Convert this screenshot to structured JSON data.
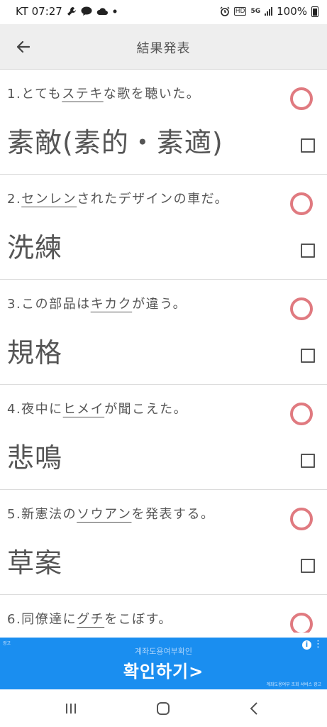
{
  "status_bar": {
    "carrier_time": "KT 07:27",
    "left_icons": [
      "wrench-icon",
      "talk-icon",
      "cloud-icon",
      "dot-icon"
    ],
    "right_icons": [
      "alarm-icon",
      "hd-icon",
      "5g-icon",
      "signal-icon"
    ],
    "hd_label": "HD",
    "network_label": "5G",
    "battery": "100%"
  },
  "header": {
    "back_icon": "arrow-left-icon",
    "title": "結果発表"
  },
  "colors": {
    "correct_circle": "#e07a80",
    "header_bg": "#eeeeee",
    "ad_bg": "#1a8ef0"
  },
  "results": [
    {
      "prefix": "1.とても",
      "kana": "ステキ",
      "suffix": "な歌を聴いた。",
      "answer": "素敵(素的・素適)",
      "mark": "correct-circle-icon"
    },
    {
      "prefix": "2.",
      "kana": "センレン",
      "suffix": "されたデザインの車だ。",
      "answer": "洗練",
      "mark": "correct-circle-icon"
    },
    {
      "prefix": "3.この部品は",
      "kana": "キカク",
      "suffix": "が違う。",
      "answer": "規格",
      "mark": "correct-circle-icon"
    },
    {
      "prefix": "4.夜中に",
      "kana": "ヒメイ",
      "suffix": "が聞こえた。",
      "answer": "悲鳴",
      "mark": "correct-circle-icon"
    },
    {
      "prefix": "5.新憲法の",
      "kana": "ソウアン",
      "suffix": "を発表する。",
      "answer": "草案",
      "mark": "correct-circle-icon"
    },
    {
      "prefix": "6.同僚達に",
      "kana": "グチ",
      "suffix": "をこぼす。",
      "answer": "",
      "mark": "correct-circle-icon"
    }
  ],
  "ad": {
    "corner_label": "광고",
    "top_text": "계좌도용여부확인",
    "main_text": "확인하기>",
    "bottom_text": "계좌도용여부 조회 서비스 광고",
    "info_icon": "info-icon",
    "info_glyph": "i",
    "menu_icon": "more-vert-icon",
    "menu_glyph": "⋮"
  },
  "nav": {
    "recents_icon": "recents-icon",
    "home_icon": "home-icon",
    "back_icon": "back-chevron-icon"
  }
}
